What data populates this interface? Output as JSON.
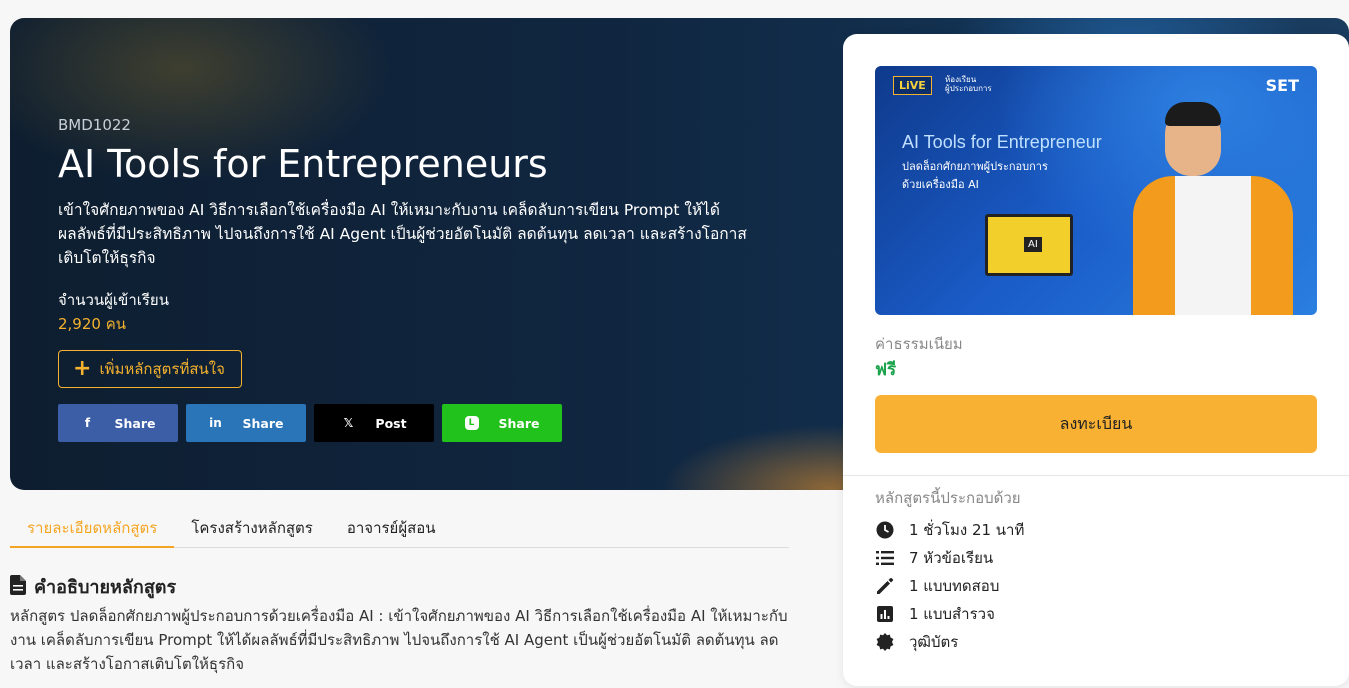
{
  "hero": {
    "course_code": "BMD1022",
    "title": "AI Tools for Entrepreneurs",
    "description": "เข้าใจศักยภาพของ AI วิธีการเลือกใช้เครื่องมือ AI ให้เหมาะกับงาน เคล็ดลับการเขียน Prompt ให้ได้ผลลัพธ์ที่มีประสิทธิภาพ ไปจนถึงการใช้ AI Agent เป็นผู้ช่วยอัตโนมัติ ลดต้นทุน ลดเวลา และสร้างโอกาสเติบโตให้ธุรกิจ",
    "enroll_label": "จำนวนผู้เข้าเรียน",
    "enroll_count": "2,920 คน",
    "favorite_label": "เพิ่มหลักสูตรที่สนใจ",
    "share": {
      "facebook": {
        "icon": "f",
        "label": "Share"
      },
      "linkedin": {
        "icon": "in",
        "label": "Share"
      },
      "x": {
        "icon": "𝕏",
        "label": "Post"
      },
      "line": {
        "icon": "L",
        "label": "Share"
      }
    }
  },
  "tabs": [
    {
      "label": "รายละเอียดหลักสูตร",
      "active": true
    },
    {
      "label": "โครงสร้างหลักสูตร",
      "active": false
    },
    {
      "label": "อาจารย์ผู้สอน",
      "active": false
    }
  ],
  "description_section": {
    "heading": "คำอธิบายหลักสูตร",
    "body": "หลักสูตร ปลดล็อกศักยภาพผู้ประกอบการด้วยเครื่องมือ AI : เข้าใจศักยภาพของ AI วิธีการเลือกใช้เครื่องมือ AI ให้เหมาะกับงาน เคล็ดลับการเขียน Prompt ให้ได้ผลลัพธ์ที่มีประสิทธิภาพ ไปจนถึงการใช้ AI Agent เป็นผู้ช่วยอัตโนมัติ ลดต้นทุน ลดเวลา และสร้างโอกาสเติบโตให้ธุรกิจ"
  },
  "card": {
    "thumbnail": {
      "logo_live": "LiVE",
      "logo_room_line1": "ห้องเรียน",
      "logo_room_line2": "ผู้ประกอบการ",
      "logo_set": "SET",
      "title": "AI Tools for Entrepreneur",
      "subtitle_line1": "ปลดล็อกศักยภาพผู้ประกอบการ",
      "subtitle_line2": "ด้วยเครื่องมือ AI",
      "screen_label": "AI"
    },
    "fee_label": "ค่าธรรมเนียม",
    "fee_value": "ฟรี",
    "register_label": "ลงทะเบียน",
    "consists_label": "หลักสูตรนี้ประกอบด้วย",
    "features": [
      {
        "icon": "clock-icon",
        "label": "1 ชั่วโมง 21 นาที"
      },
      {
        "icon": "list-icon",
        "label": "7 หัวข้อเรียน"
      },
      {
        "icon": "pencil-icon",
        "label": "1 แบบทดสอบ"
      },
      {
        "icon": "chart-icon",
        "label": "1 แบบสำรวจ"
      },
      {
        "icon": "badge-icon",
        "label": "วุฒิบัตร"
      }
    ]
  },
  "colors": {
    "accent": "#f4a623",
    "register_button": "#f8b133",
    "free_text": "#1aa34a",
    "facebook": "#3b5ea6",
    "linkedin": "#2a74b8",
    "x": "#000000",
    "line": "#22c21c"
  }
}
